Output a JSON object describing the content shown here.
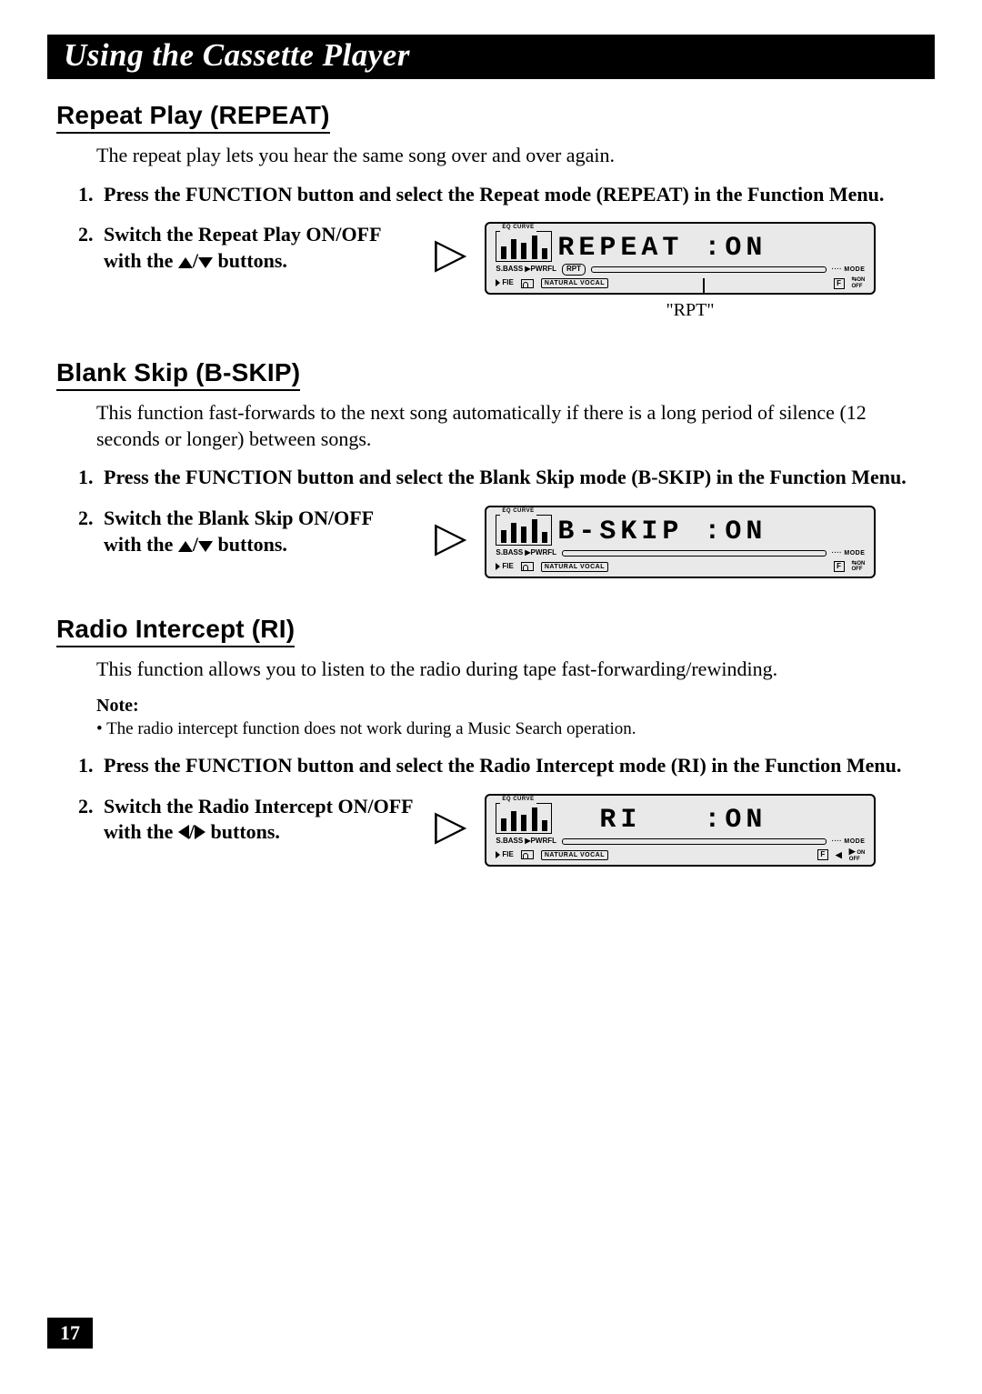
{
  "page_title": "Using the Cassette Player",
  "page_number": "17",
  "lcd_labels": {
    "eq": "EQ CURVE",
    "sbass": "S.BASS ▶PWRFL",
    "mode_dots": "···· MODE",
    "fie": "FIE",
    "nv": "NATURAL VOCAL",
    "f": "F",
    "on": "ON",
    "off": "OFF"
  },
  "sections": [
    {
      "heading": "Repeat Play (REPEAT)",
      "intro": "The repeat play lets you hear the same song over and over again.",
      "steps": [
        {
          "num": "1.",
          "text": "Press the FUNCTION button and select the Repeat mode (REPEAT) in the Function Menu."
        },
        {
          "num": "2.",
          "text_a": "Switch the Repeat Play ON/OFF with the ",
          "text_b": " buttons.",
          "buttons": "updown"
        }
      ],
      "lcd_main": "REPEAT :ON",
      "lcd_rpt": "RPT",
      "caption": "\"RPT\""
    },
    {
      "heading": "Blank Skip (B-SKIP)",
      "intro": "This function fast-forwards to the next song automatically if there is a long period of silence (12 seconds or longer) between songs.",
      "steps": [
        {
          "num": "1.",
          "text": "Press the FUNCTION button and select the Blank Skip mode (B-SKIP) in the Function Menu."
        },
        {
          "num": "2.",
          "text_a": "Switch the Blank Skip ON/OFF with the ",
          "text_b": " buttons.",
          "buttons": "updown"
        }
      ],
      "lcd_main": "B-SKIP :ON"
    },
    {
      "heading": "Radio Intercept (RI)",
      "intro": "This function allows you to listen to the radio during tape fast-forwarding/rewinding.",
      "note_label": "Note:",
      "note_text": "The radio intercept function does not work during a Music Search operation.",
      "steps": [
        {
          "num": "1.",
          "text": "Press the FUNCTION button and select the Radio Intercept mode (RI) in the Function Menu."
        },
        {
          "num": "2.",
          "text_a": "Switch the Radio Intercept ON/OFF with the ",
          "text_b": " buttons.",
          "buttons": "leftright"
        }
      ],
      "lcd_main": "  RI   :ON",
      "lcd_lr": true
    }
  ]
}
